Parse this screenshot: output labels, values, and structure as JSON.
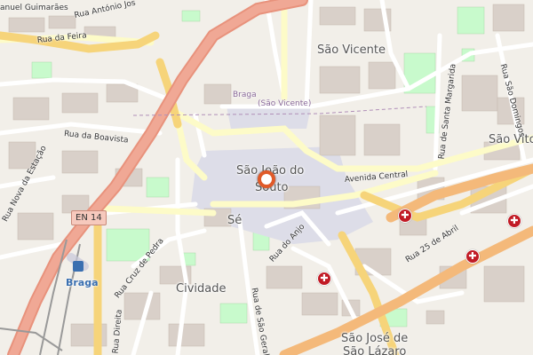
{
  "map": {
    "districts": {
      "sao_vicente": "São Vicente",
      "sao_vitor": "São Vito",
      "sao_joao_do_souto_1": "São João do",
      "sao_joao_do_souto_2": "Souto",
      "se": "Sé",
      "cividade": "Cividade",
      "sao_jose_1": "São José de",
      "sao_jose_2": "São Lázaro"
    },
    "streets": {
      "rua_da_feira": "Rua da Feira",
      "braga_sao_vicente_1": "Braga",
      "braga_sao_vicente_2": "(São Vicente)",
      "rua_da_boavista": "Rua da Boavista",
      "rua_nova_estacao": "Rua Nova da Estação",
      "avenida_central": "Avenida Central",
      "rua_25_abril": "Rua 25 de Abril",
      "rua_do_anjo": "Rua do Anjo",
      "rua_cruz_pedra": "Rua Cruz de Pedra",
      "rua_direita": "Rua Direita",
      "rua_sao_geraldo": "Rua de São Geraldo",
      "rua_santa_margarida": "Rua de Santa Margarida",
      "rua_sao_domingos": "Rua São Domingos",
      "rua_antonio": "Rua António Jos",
      "manuel_guimaraes": "anuel Guimarães"
    },
    "road_shield": "EN 14",
    "station_label": "Braga",
    "hospital_symbol": "✚",
    "colors": {
      "primary_road": "#e8927c",
      "secondary_road": "#f6d47a",
      "tertiary_road": "#fdfbc8",
      "residential_road": "#ffffff",
      "pedestrian": "#dddde8",
      "park": "#c8facc",
      "building": "#d9d0c9",
      "background": "#f2efe9",
      "hospital": "#c11b25",
      "marker": "#e05a29",
      "railway": "#999999"
    }
  }
}
